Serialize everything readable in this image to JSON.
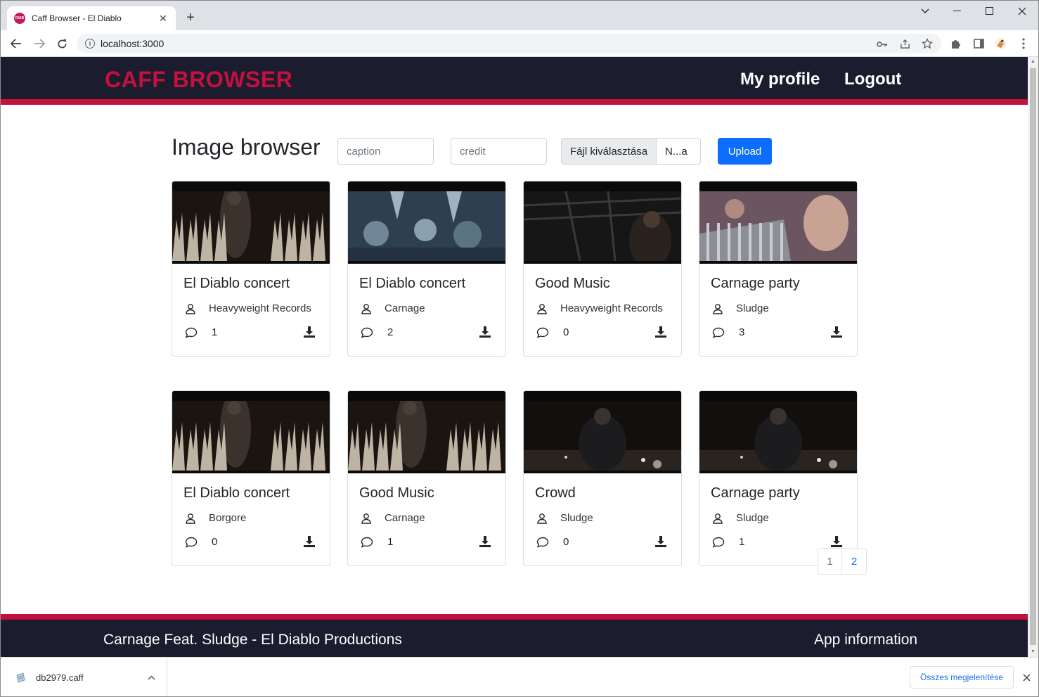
{
  "browser": {
    "tab_title": "Caff Browser - El Diablo",
    "favicon_text": "DIAB",
    "url": "localhost:3000",
    "new_tab": "+",
    "tab_close": "✕"
  },
  "header": {
    "brand": "CAFF BROWSER",
    "nav": [
      "My profile",
      "Logout"
    ]
  },
  "main": {
    "title": "Image browser",
    "caption_placeholder": "caption",
    "credit_placeholder": "credit",
    "file_button": "Fájl kiválasztása",
    "file_name": "N...a",
    "upload_label": "Upload"
  },
  "cards": [
    {
      "title": "El Diablo concert",
      "credit": "Heavyweight Records",
      "comments": "1",
      "scene": "stage"
    },
    {
      "title": "El Diablo concert",
      "credit": "Carnage",
      "comments": "2",
      "scene": "crowd-blue"
    },
    {
      "title": "Good Music",
      "credit": "Heavyweight Records",
      "comments": "0",
      "scene": "dark-stage"
    },
    {
      "title": "Carnage party",
      "credit": "Sludge",
      "comments": "3",
      "scene": "fans"
    },
    {
      "title": "El Diablo concert",
      "credit": "Borgore",
      "comments": "0",
      "scene": "stage"
    },
    {
      "title": "Good Music",
      "credit": "Carnage",
      "comments": "1",
      "scene": "stage"
    },
    {
      "title": "Crowd",
      "credit": "Sludge",
      "comments": "0",
      "scene": "performer"
    },
    {
      "title": "Carnage party",
      "credit": "Sludge",
      "comments": "1",
      "scene": "performer"
    }
  ],
  "pagination": [
    "1",
    "2"
  ],
  "footer": {
    "left": "Carnage Feat. Sludge - El Diablo Productions",
    "right": "App information"
  },
  "downloads": {
    "file": "db2979.caff",
    "show_all": "Összes megjelenítése"
  },
  "colors": {
    "accent": "#c3113f",
    "nav_bg": "#1b1c2e",
    "primary": "#0d6efd"
  }
}
